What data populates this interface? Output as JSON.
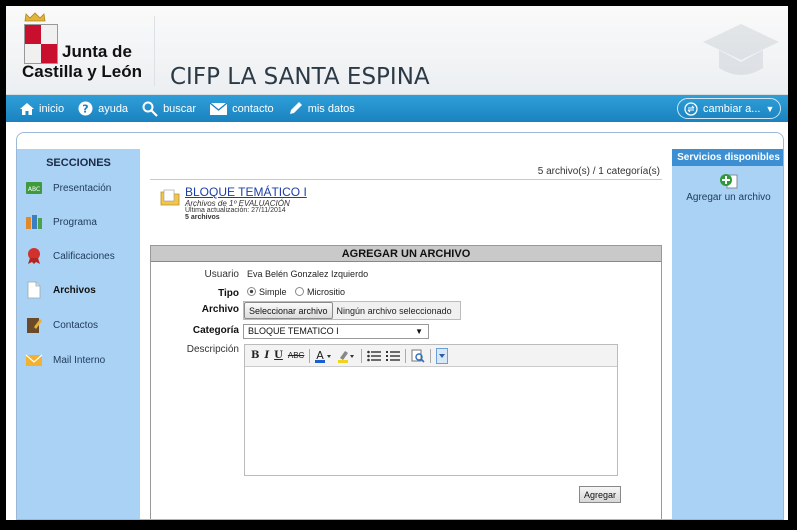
{
  "header": {
    "logo_line1": "Junta de",
    "logo_line2": "Castilla y León",
    "site_title": "CIFP LA SANTA ESPINA"
  },
  "nav": {
    "items": [
      {
        "label": "inicio",
        "icon": "home-icon"
      },
      {
        "label": "ayuda",
        "icon": "help-icon"
      },
      {
        "label": "buscar",
        "icon": "search-icon"
      },
      {
        "label": "contacto",
        "icon": "mail-icon"
      },
      {
        "label": "mis datos",
        "icon": "pencil-icon"
      }
    ],
    "switch_label": "cambiar a..."
  },
  "sidebar": {
    "title": "SECCIONES",
    "items": [
      {
        "label": "Presentación",
        "icon": "abc-icon"
      },
      {
        "label": "Programa",
        "icon": "program-icon"
      },
      {
        "label": "Calificaciones",
        "icon": "award-icon"
      },
      {
        "label": "Archivos",
        "icon": "file-icon"
      },
      {
        "label": "Contactos",
        "icon": "contacts-icon"
      },
      {
        "label": "Mail Interno",
        "icon": "envelope-icon"
      }
    ]
  },
  "services": {
    "title": "Servicios disponibles",
    "add_file": "Agregar un archivo"
  },
  "main": {
    "counts": "5 archivo(s) / 1 categoría(s)",
    "block": {
      "name": "BLOQUE TEMÁTICO I",
      "subtitle": "Archivos de 1º EVALUACIÓN",
      "updated": "Última actualización: 27/11/2014",
      "count": "5 archivos"
    }
  },
  "form": {
    "title": "AGREGAR UN ARCHIVO",
    "user_label": "Usuario",
    "user_value": "Eva Belén Gonzalez Izquierdo",
    "type_label": "Tipo",
    "type_options": [
      "Simple",
      "Micrositio"
    ],
    "type_selected": "Simple",
    "file_label": "Archivo",
    "file_button": "Seleccionar archivo",
    "file_status": "Ningún archivo seleccionado",
    "category_label": "Categoría",
    "category_value": "BLOQUE TEMATICO I",
    "description_label": "Descripción",
    "submit": "Agregar"
  },
  "colors": {
    "nav": "#1a82c0",
    "sidebar": "#a9d2f4",
    "services_header": "#3b8fd2",
    "link": "#1b3ea6"
  }
}
